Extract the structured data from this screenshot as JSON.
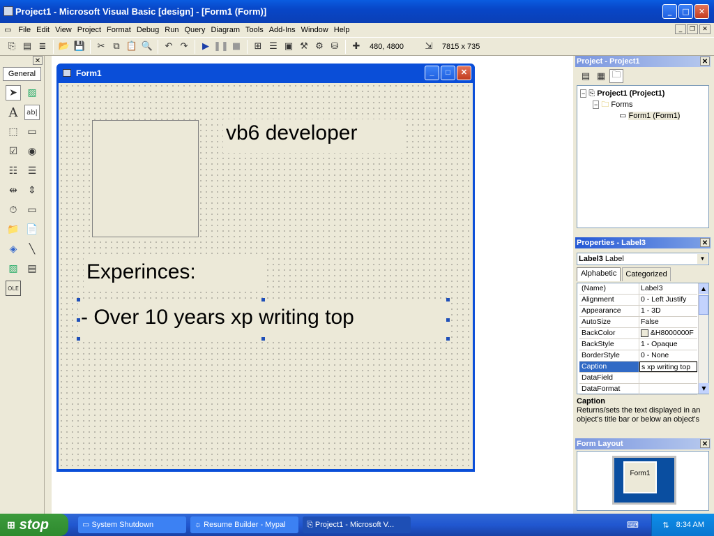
{
  "window": {
    "title": "Project1 - Microsoft Visual Basic [design] - [Form1 (Form)]"
  },
  "menu": [
    "File",
    "Edit",
    "View",
    "Project",
    "Format",
    "Debug",
    "Run",
    "Query",
    "Diagram",
    "Tools",
    "Add-Ins",
    "Window",
    "Help"
  ],
  "toolbar": {
    "position": "480, 4800",
    "size": "7815 x 735"
  },
  "toolbox": {
    "tab": "General"
  },
  "form": {
    "title": "Form1",
    "label1": "vb6 developer",
    "label2": "Experinces:",
    "label3": "- Over 10 years xp writing top"
  },
  "project": {
    "title": "Project - Project1",
    "root": "Project1 (Project1)",
    "folder": "Forms",
    "item": "Form1 (Form1)"
  },
  "properties": {
    "title": "Properties - Label3",
    "object": "Label3",
    "object_type": "Label",
    "tabs": [
      "Alphabetic",
      "Categorized"
    ],
    "rows": [
      {
        "name": "(Name)",
        "value": "Label3"
      },
      {
        "name": "Alignment",
        "value": "0 - Left Justify"
      },
      {
        "name": "Appearance",
        "value": "1 - 3D"
      },
      {
        "name": "AutoSize",
        "value": "False"
      },
      {
        "name": "BackColor",
        "value": "&H8000000F"
      },
      {
        "name": "BackStyle",
        "value": "1 - Opaque"
      },
      {
        "name": "BorderStyle",
        "value": "0 - None"
      },
      {
        "name": "Caption",
        "value": "s xp writing top"
      },
      {
        "name": "DataField",
        "value": ""
      },
      {
        "name": "DataFormat",
        "value": ""
      }
    ],
    "desc_title": "Caption",
    "desc_text": "Returns/sets the text displayed in an object's title bar or below an object's"
  },
  "form_layout": {
    "title": "Form Layout",
    "preview": "Form1"
  },
  "taskbar": {
    "start": "stop",
    "tasks": [
      "System Shutdown",
      "Resume Builder - Mypal",
      "Project1 - Microsoft V..."
    ],
    "clock": "8:34 AM"
  },
  "colors": {
    "titlebar": "#0a4ed8",
    "selection": "#316ac5",
    "form_bg": "#ece9d8"
  }
}
